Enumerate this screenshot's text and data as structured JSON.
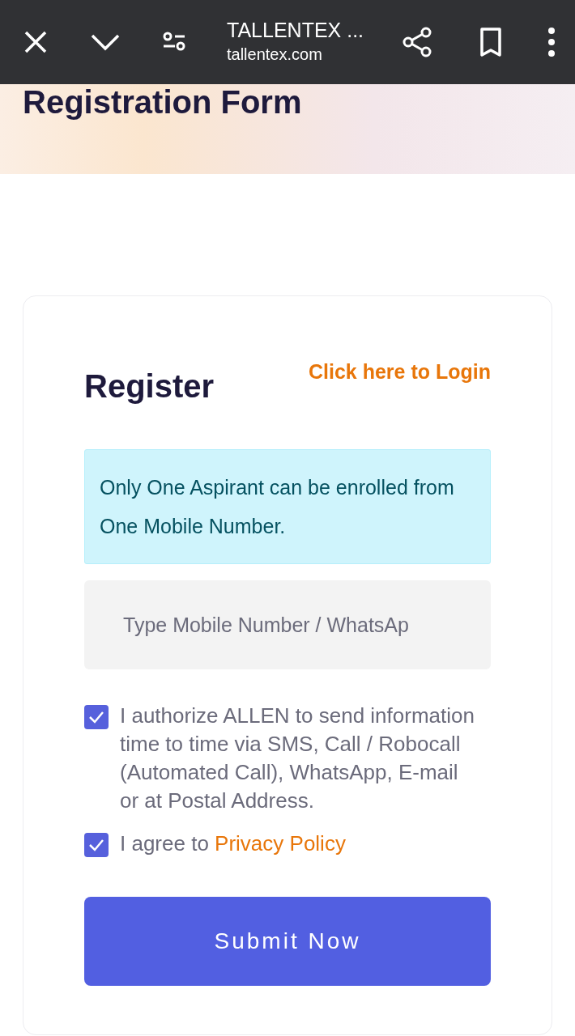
{
  "browser_bar": {
    "title": "TALLENTEX ...",
    "url": "tallentex.com"
  },
  "banner": {
    "title": "Registration Form"
  },
  "form": {
    "title": "Register",
    "login_link": "Click here to Login",
    "notice": "Only One Aspirant can be enrolled from One Mobile Number.",
    "mobile_field": {
      "placeholder": "Type Mobile Number / WhatsAp"
    },
    "consents": [
      {
        "text": "I authorize ALLEN to send information time to time via SMS, Call / Robocall (Automated Call), WhatsApp, E-mail or at Postal Address.",
        "checked": true
      },
      {
        "text": "I agree to ",
        "link": "Privacy Policy",
        "checked": true
      }
    ],
    "submit": "Submit Now"
  }
}
